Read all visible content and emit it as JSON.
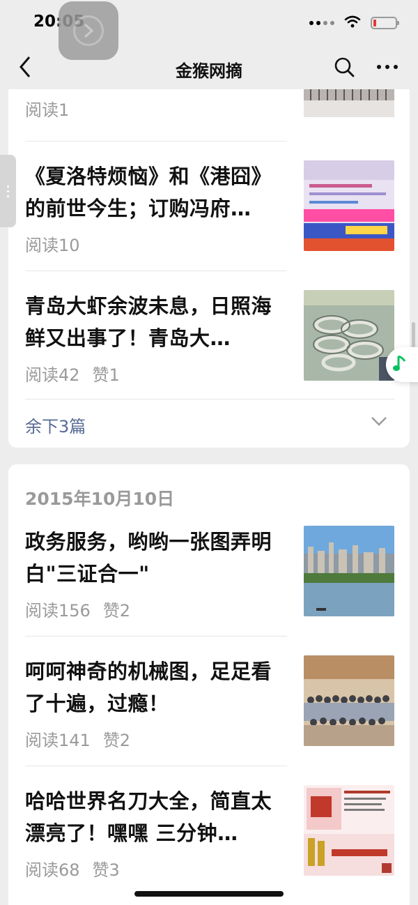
{
  "status_bar": {
    "time": "20:05"
  },
  "nav": {
    "title": "金猴网摘"
  },
  "colors": {
    "background": "#ededed",
    "card": "#ffffff",
    "link": "#576b95",
    "meta_text": "#9a9a9a",
    "music_accent": "#07c160",
    "battery_low": "#e53935"
  },
  "icons": [
    "back-arrow-icon",
    "search-icon",
    "more-icon",
    "chevron-down-icon",
    "music-note-icon",
    "wifi-icon",
    "battery-icon",
    "signal-icon"
  ],
  "group_1": {
    "articles": [
      {
        "title": "",
        "meta": [
          "阅读1"
        ]
      },
      {
        "title": "《夏洛特烦恼》和《港囧》的前世今生；订购冯府…",
        "meta": [
          "阅读10"
        ]
      },
      {
        "title": "青岛大虾余波未息，日照海鲜又出事了！青岛大…",
        "meta": [
          "阅读42",
          "赞1"
        ]
      }
    ],
    "more_label": "余下3篇"
  },
  "group_2": {
    "date": "2015年10月10日",
    "articles": [
      {
        "title": "政务服务，哟哟一张图弄明白\"三证合一\"",
        "meta": [
          "阅读156",
          "赞2"
        ]
      },
      {
        "title": "呵呵神奇的机械图，足足看了十遍，过瘾！",
        "meta": [
          "阅读141",
          "赞2"
        ]
      },
      {
        "title": "哈哈世界名刀大全，简直太漂亮了！嘿嘿 三分钟…",
        "meta": [
          "阅读68",
          "赞3"
        ]
      }
    ]
  }
}
